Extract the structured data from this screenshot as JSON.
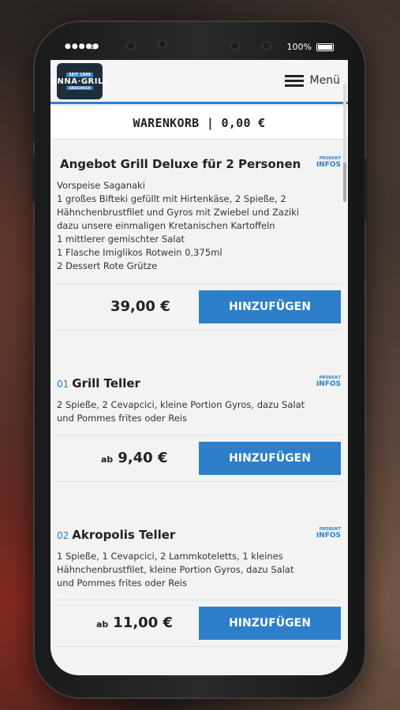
{
  "status": {
    "battery_text": "100%"
  },
  "header": {
    "logo": {
      "line1": "SEIT 1999",
      "line2": "ANNA·GRILL",
      "line3": "GRIECHISCH"
    },
    "menu_label": "Menü"
  },
  "cart": {
    "label": "WARENKORB | 0,00 €"
  },
  "items": [
    {
      "number": "",
      "title": "Angebot Grill Deluxe für 2 Personen",
      "description": [
        "Vorspeise Saganaki",
        "1 großes Bifteki gefüllt mit Hirtenkäse, 2 Spieße, 2",
        "Hähnchenbrustfilet und Gyros mit Zwiebel und Zaziki",
        "dazu unsere einmaligen Kretanischen Kartoffeln",
        "1 mittlerer gemischter Salat",
        "1 Flasche Imiglikos Rotwein 0,375ml",
        "2 Dessert Rote Grütze"
      ],
      "price_prefix": "",
      "price": "39,00 €",
      "button": "HINZUFÜGEN",
      "info_small": "PRODUKT",
      "info_large": "INFOS"
    },
    {
      "number": "01",
      "title": "Grill Teller",
      "description": [
        "2 Spieße, 2 Cevapcici, kleine Portion Gyros, dazu Salat",
        "und Pommes frites oder Reis"
      ],
      "price_prefix": "ab",
      "price": "9,40 €",
      "button": "HINZUFÜGEN",
      "info_small": "PRODUKT",
      "info_large": "INFOS"
    },
    {
      "number": "02",
      "title": "Akropolis Teller",
      "description": [
        "1 Spieße, 1 Cevapcici, 2 Lammkoteletts, 1 kleines",
        "Hähnchenbrustfilet, kleine Portion Gyros, dazu Salat",
        "und Pommes frites oder Reis"
      ],
      "price_prefix": "ab",
      "price": "11,00 €",
      "button": "HINZUFÜGEN",
      "info_small": "PRODUKT",
      "info_large": "INFOS"
    }
  ],
  "colors": {
    "accent": "#2d7fc9"
  }
}
